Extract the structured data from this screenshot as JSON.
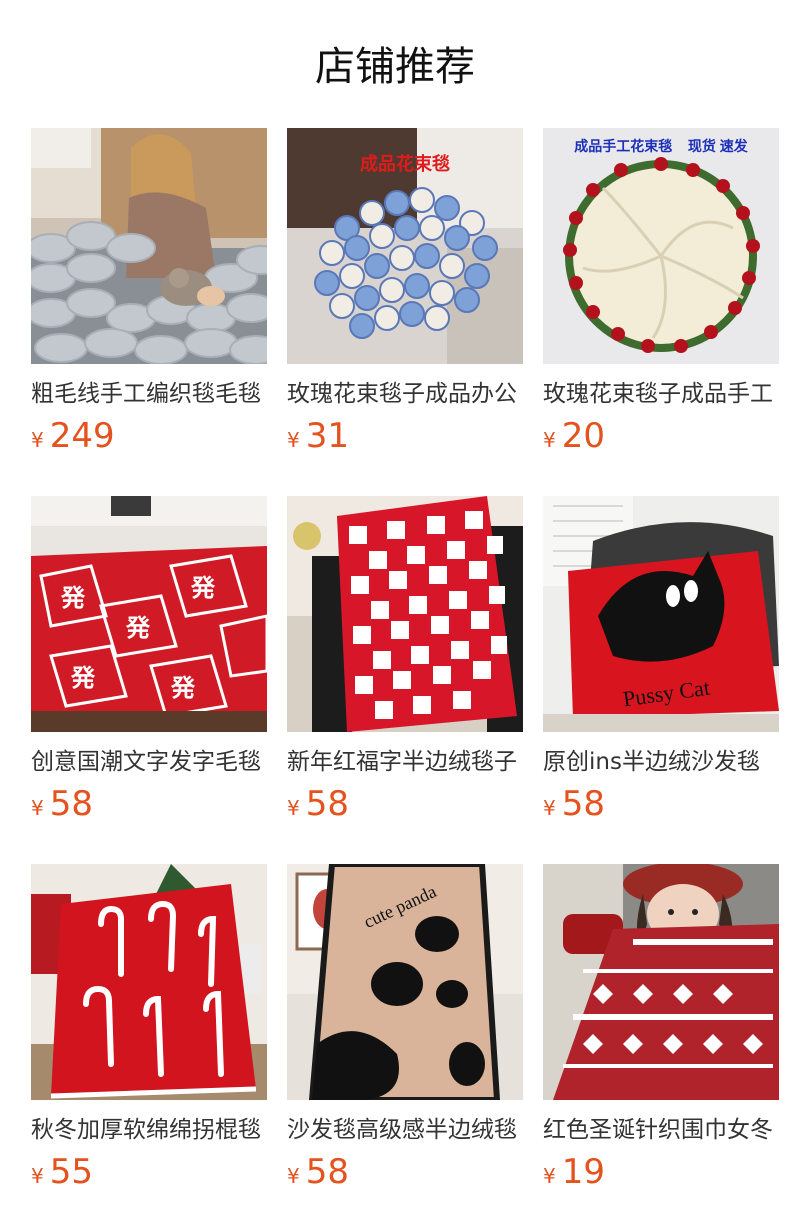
{
  "section": {
    "title": "店铺推荐"
  },
  "currency_symbol": "¥",
  "accent_color": "#e4521d",
  "products": [
    {
      "name": "粗毛线手工编织毯毛毯",
      "price": "249"
    },
    {
      "name": "玫瑰花束毯子成品办公",
      "price": "31",
      "image_caption": "成品花束毯"
    },
    {
      "name": "玫瑰花束毯子成品手工",
      "price": "20",
      "image_caption": "成品手工花束毯    现货 速发"
    },
    {
      "name": "创意国潮文字发字毛毯",
      "price": "58"
    },
    {
      "name": "新年红福字半边绒毯子",
      "price": "58"
    },
    {
      "name": "原创ins半边绒沙发毯",
      "price": "58",
      "image_caption": "Pussy Cat"
    },
    {
      "name": "秋冬加厚软绵绵拐棍毯",
      "price": "55"
    },
    {
      "name": "沙发毯高级感半边绒毯",
      "price": "58",
      "image_caption": "cute panda"
    },
    {
      "name": "红色圣诞针织围巾女冬",
      "price": "19"
    }
  ]
}
